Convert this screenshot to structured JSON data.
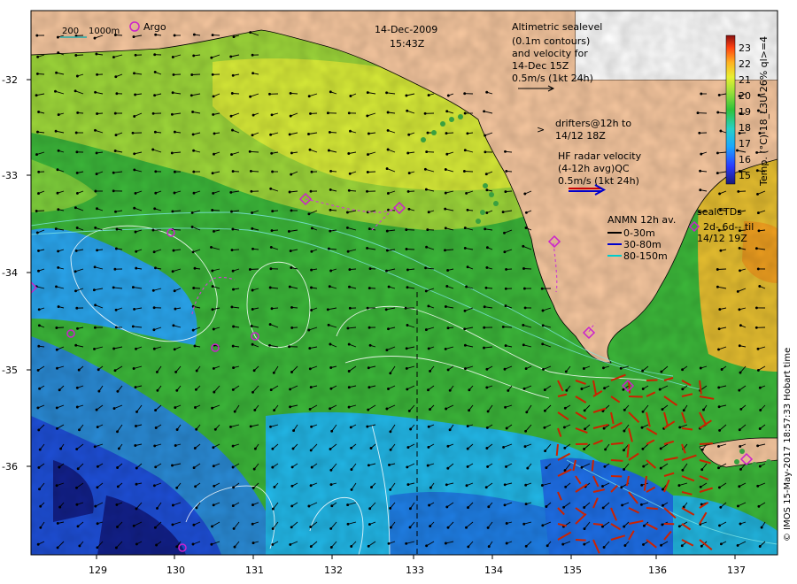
{
  "header": {
    "date": "14-Dec-2009",
    "time": "15:43Z"
  },
  "legend": {
    "scale_200": "200",
    "scale_1000": "1000m",
    "argo": "Argo",
    "altimetry": [
      "Altimetric sealevel",
      "(0.1m contours)",
      "and velocity for",
      "14-Dec 15Z",
      "0.5m/s (1kt 24h)"
    ],
    "drifters": [
      "drifters@12h to",
      "14/12 18Z"
    ],
    "drifter_symbol": ">",
    "hf_radar": [
      "HF radar velocity",
      "(4-12h avg)QC",
      "0.5m/s (1kt 24h)"
    ],
    "anmn_title": "ANMN 12h av.",
    "anmn_items": [
      "0-30m",
      "30-80m",
      "80-150m"
    ],
    "anmn_colors": [
      "#000000",
      "#0000cc",
      "#00cccc"
    ],
    "sealctds": [
      "sealCTDs",
      "2d-  6d-- til",
      "14/12 19Z"
    ]
  },
  "colorbar": {
    "title": "Temp. (°C) 18_L3U 26% ql>=4",
    "ticks": [
      "23",
      "22",
      "21",
      "20",
      "19",
      "18",
      "17",
      "16",
      "15"
    ],
    "vmin": 14.5,
    "vmax": 23.5
  },
  "axes": {
    "x_ticks": [
      "129",
      "130",
      "131",
      "132",
      "133",
      "134",
      "135",
      "136",
      "137"
    ],
    "y_ticks": [
      "-32",
      "-33",
      "-34",
      "-35",
      "-36"
    ],
    "x_range": [
      128.2,
      137.6
    ],
    "y_range": [
      -36.9,
      -31.3
    ]
  },
  "credit": "© IMOS 15-May-2017 18:57:33 Hobart time"
}
